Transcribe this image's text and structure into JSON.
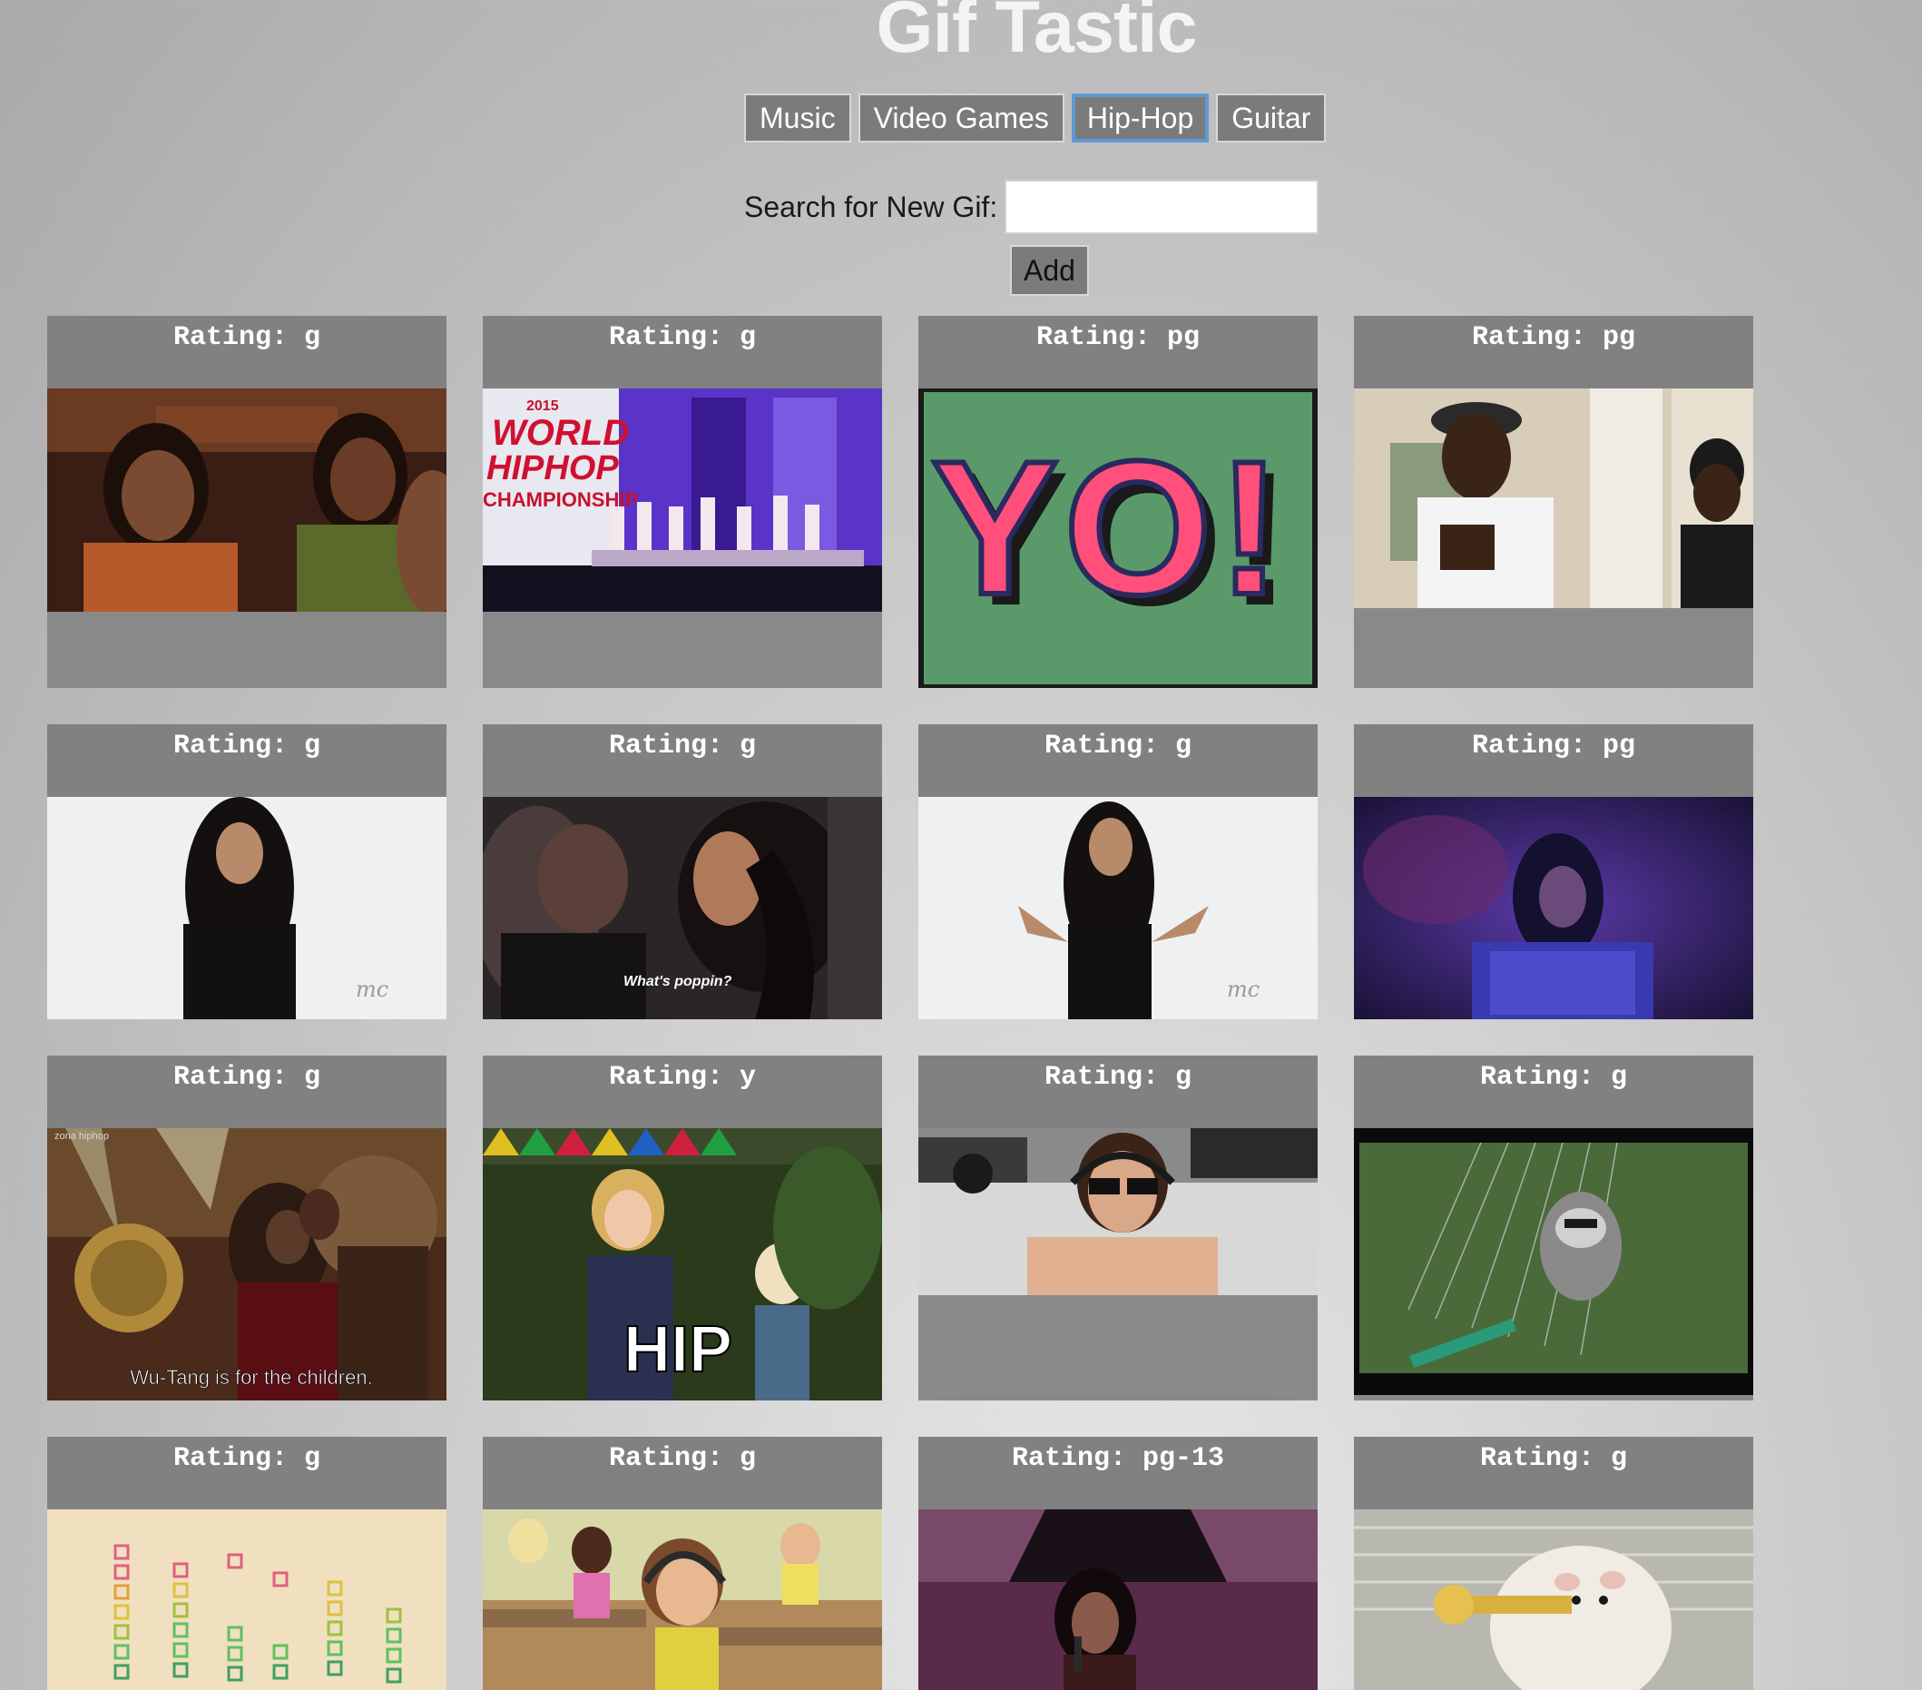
{
  "page": {
    "title": "Gif Tastic"
  },
  "topics": [
    {
      "label": "Music",
      "active": false
    },
    {
      "label": "Video Games",
      "active": false
    },
    {
      "label": "Hip-Hop",
      "active": true
    },
    {
      "label": "Guitar",
      "active": false
    }
  ],
  "search": {
    "label": "Search for New Gif:",
    "value": "",
    "add_label": "Add"
  },
  "gifs": [
    {
      "rating": "Rating: g",
      "subject": "two women clapping and laughing in audience",
      "caption": ""
    },
    {
      "rating": "Rating: g",
      "subject": "kids dance crew on stage, 2015 World Hip Hop Championship",
      "caption": "",
      "scene_text": [
        "2015",
        "WORLD",
        "HIPHOP",
        "CHAMPIONSHIP"
      ]
    },
    {
      "rating": "Rating: pg",
      "subject": "pink and blue YO! lettering on green",
      "caption": "",
      "scene_text": [
        "YO!"
      ]
    },
    {
      "rating": "Rating: pg",
      "subject": "man in cap and glasses gesturing in hallway",
      "caption": ""
    },
    {
      "rating": "Rating: g",
      "subject": "woman with long dark hair on white background",
      "caption": ""
    },
    {
      "rating": "Rating: g",
      "subject": "woman with braids at a party",
      "caption": "What's poppin?"
    },
    {
      "rating": "Rating: g",
      "subject": "woman with long hair gesturing on white background",
      "caption": ""
    },
    {
      "rating": "Rating: pg",
      "subject": "singer in sparkly jacket under blue purple light",
      "caption": ""
    },
    {
      "rating": "Rating: g",
      "subject": "man singing at microphone in ornate room",
      "caption": "Wu-Tang is for the children."
    },
    {
      "rating": "Rating: y",
      "subject": "girl and boy at colorful party",
      "caption": "HIP"
    },
    {
      "rating": "Rating: g",
      "subject": "man in headphones and sunglasses by cars",
      "caption": ""
    },
    {
      "rating": "Rating: g",
      "subject": "raccoon playing harp strings on grass",
      "caption": ""
    },
    {
      "rating": "Rating: g",
      "subject": "colorful equalizer bars on beige paper",
      "caption": ""
    },
    {
      "rating": "Rating: g",
      "subject": "cartoon boy with headphones in cafeteria",
      "caption": ""
    },
    {
      "rating": "Rating: pg-13",
      "subject": "woman singing into microphone on purple stage",
      "caption": ""
    },
    {
      "rating": "Rating: g",
      "subject": "hamster playing a trumpet",
      "caption": ""
    }
  ],
  "colors": {
    "button_bg": "#7b7b7b",
    "active_border": "#5f9ad6",
    "card_bg": "#898989",
    "title": "#f4f4f4"
  }
}
